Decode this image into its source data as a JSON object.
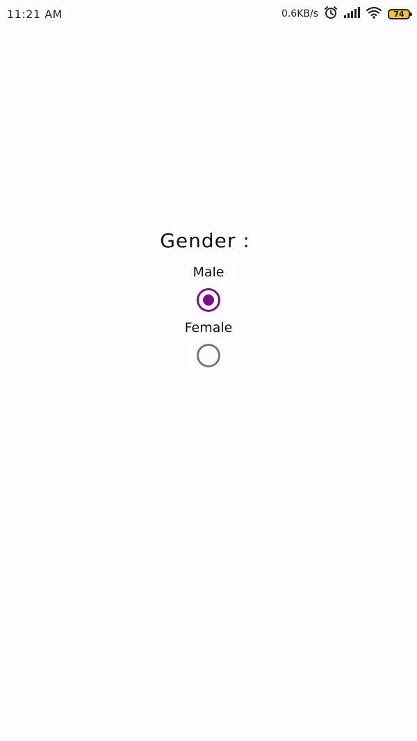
{
  "status_bar": {
    "time": "11:21 AM",
    "net_speed": "0.6KB/s",
    "battery": "74"
  },
  "form": {
    "title": "Gender :",
    "options": [
      {
        "label": "Male",
        "checked": true
      },
      {
        "label": "Female",
        "checked": false
      }
    ]
  },
  "colors": {
    "accent": "#7b0f86",
    "unchecked": "#777777",
    "background": "#fefcfe"
  }
}
